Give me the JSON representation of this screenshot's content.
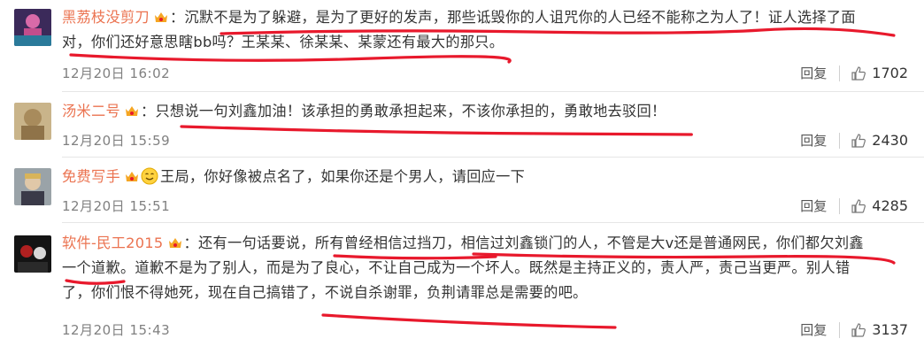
{
  "comments": [
    {
      "username": "黑荔枝没剪刀",
      "text_l1": "：沉默不是为了躲避，是为了更好的发声，那些诋毁你的人诅咒你的人已经不能称之为人了！证人选择了面",
      "text_l2": "对，你们还好意思瞎bb吗？王某某、徐某某、某蒙还有最大的那只。",
      "date": "12月20日 16:02",
      "reply": "回复",
      "likes": "1702"
    },
    {
      "username": "汤米二号",
      "text_l1": "：只想说一句刘鑫加油！该承担的勇敢承担起来，不该你承担的，勇敢地去驳回！",
      "date": "12月20日 15:59",
      "reply": "回复",
      "likes": "2430"
    },
    {
      "username": "免费写手",
      "text_l1": "王局，你好像被点名了，如果你还是个男人，请回应一下",
      "date": "12月20日 15:51",
      "reply": "回复",
      "likes": "4285"
    },
    {
      "username": "软件-民工2015",
      "text_l1": "：还有一句话要说，所有曾经相信过挡刀，相信过刘鑫锁门的人，不管是大v还是普通网民，你们都欠刘鑫",
      "text_l2": "一个道歉。道歉不是为了别人，而是为了良心，不让自己成为一个坏人。既然是主持正义的，责人严，责己当更严。别人错",
      "text_l3": "了，你们恨不得她死，现在自己搞错了，不说自杀谢罪，负荆请罪总是需要的吧。",
      "date": "12月20日 15:43",
      "reply": "回复",
      "likes": "3137"
    }
  ],
  "colors": {
    "username": "#eb7350",
    "underline": "#e8192c",
    "meta": "#808080"
  },
  "icons": [
    "vip-crown-icon",
    "thumbs-up-icon",
    "smile-emoji-icon"
  ]
}
